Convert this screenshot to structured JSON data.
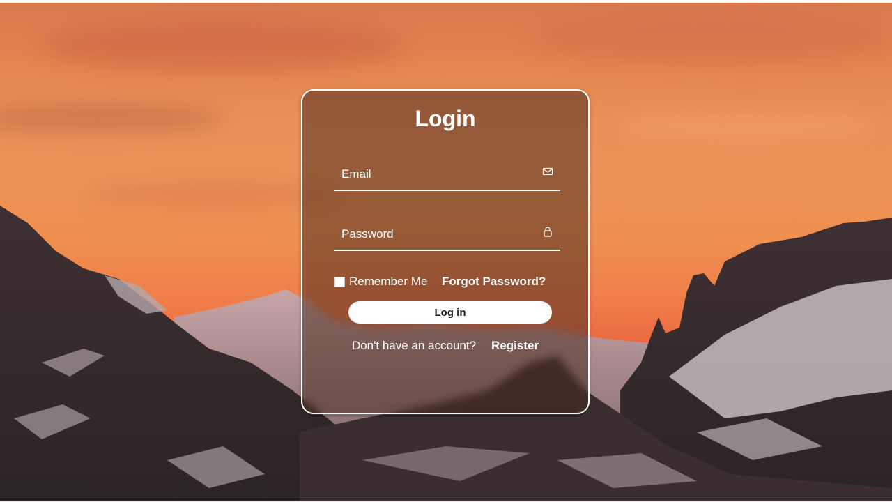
{
  "login": {
    "title": "Login",
    "email": {
      "placeholder": "Email",
      "icon": "envelope-icon"
    },
    "password": {
      "placeholder": "Password",
      "icon": "lock-icon"
    },
    "remember_label": "Remember Me",
    "forgot_label": "Forgot Password?",
    "submit_label": "Log in",
    "no_account_text": "Don't have an account?",
    "register_label": "Register"
  },
  "colors": {
    "sky_top": "#d9784f",
    "sky_horizon": "#f07a48",
    "card_tint": "#46281c",
    "button_bg": "#ffffff",
    "text": "#ffffff"
  }
}
